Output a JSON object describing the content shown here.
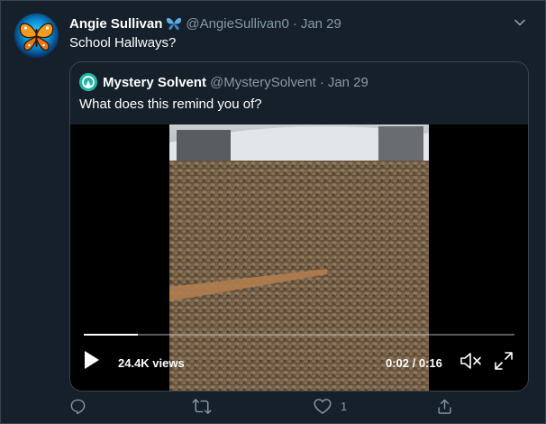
{
  "tweet": {
    "author_name": "Angie Sullivan",
    "author_badge_icon": "butterfly-emoji",
    "handle": "@AngieSullivan0",
    "separator": "·",
    "date": "Jan 29",
    "text": "School Hallways?"
  },
  "quoted": {
    "author_name": "Mystery Solvent",
    "handle": "@MysterySolvent",
    "separator": "·",
    "date": "Jan 29",
    "text": "What does this remind you of?"
  },
  "video": {
    "views": "24.4K views",
    "time": "0:02 / 0:16",
    "progress_fraction": 0.125
  },
  "actions": {
    "reply_count": "",
    "retweet_count": "",
    "like_count": "1",
    "share_count": ""
  },
  "colors": {
    "background": "#15202b",
    "border": "#38444d",
    "muted_text": "#8899a6",
    "text": "#ffffff"
  }
}
